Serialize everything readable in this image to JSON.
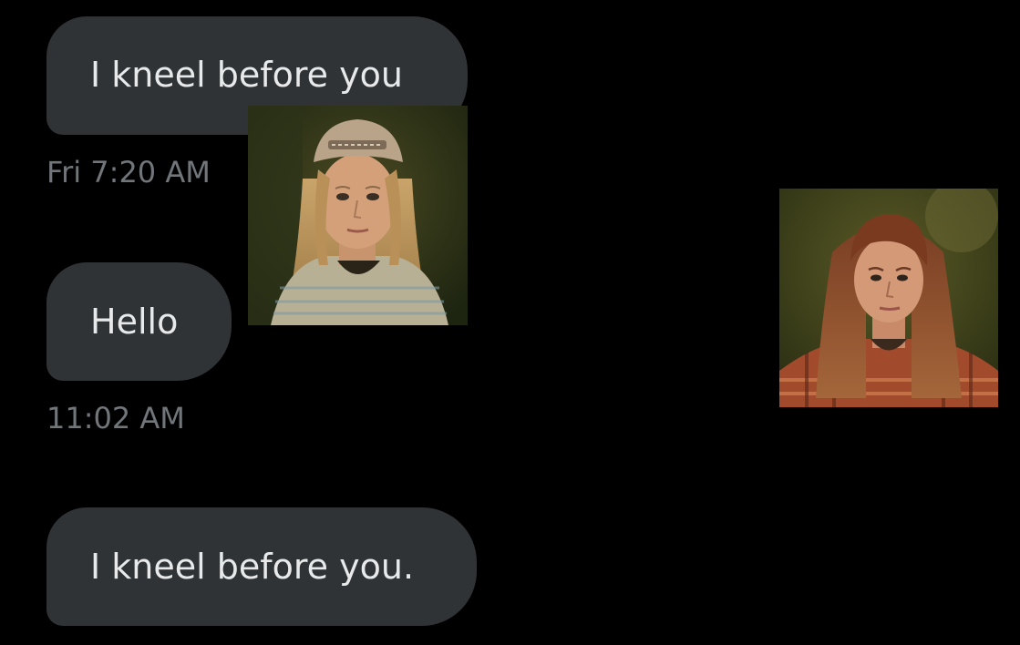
{
  "conversation": {
    "messages": [
      {
        "text": "I kneel before you"
      },
      {
        "text": "Hello"
      },
      {
        "text": "I kneel before you."
      }
    ],
    "timestamps": [
      "Fri 7:20 AM",
      "11:02 AM"
    ]
  },
  "avatars": [
    {
      "icon": "portrait-blonde-cap-photo"
    },
    {
      "icon": "portrait-redhead-plaid-photo"
    }
  ],
  "colors": {
    "background": "#000000",
    "bubble": "#2f3336",
    "bubble_text": "#e7e9ea",
    "timestamp_text": "#71767b"
  }
}
